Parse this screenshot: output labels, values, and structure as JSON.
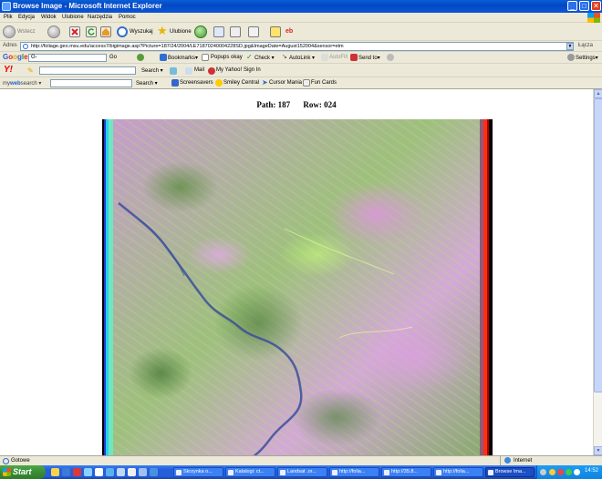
{
  "window": {
    "title": "Browse Image - Microsoft Internet Explorer",
    "min_glyph": "_",
    "max_glyph": "□",
    "close_glyph": "✕"
  },
  "menu": {
    "items": [
      "Plik",
      "Edycja",
      "Widok",
      "Ulubione",
      "Narzędzia",
      "Pomoc"
    ]
  },
  "toolbar": {
    "back_label": "Wstecz",
    "search_label": "Wyszukaj",
    "favorites_label": "Ulubione"
  },
  "address": {
    "label": "Adres",
    "url": "http://foliage.geo.msu.edu/access7/bigimage.asp?Picture=187/24/2004/LE71870240004228SD.jpg&ImageDate=August152004&sensor=etm",
    "go_label": "Łącza"
  },
  "google": {
    "logo": "Google",
    "input_value": "G-",
    "go_label": "Go",
    "bookmarks_label": "Bookmarks▾",
    "popups_label": "Popups okay",
    "check_label": "Check ▾",
    "autolink_label": "AutoLink ▾",
    "autofill_label": "AutoFill",
    "sendto_label": "Send to▾",
    "settings_label": "Settings▾"
  },
  "yahoo": {
    "logo": "Y!",
    "search_label": "Search ▾",
    "mail_label": "Mail",
    "myyahoo_label": "My Yahoo!",
    "signin_label": "Sign In"
  },
  "mws": {
    "logo_prefix": "my",
    "logo_mid": "web",
    "logo_suffix": "search ▾",
    "search_label": "Search ▾",
    "screensavers_label": "Screensavers",
    "smiley_label": "Smiley Central",
    "cursor_label": "Cursor Mania",
    "funcards_label": "Fun Cards"
  },
  "page": {
    "path_label": "Path: 187",
    "row_label": "Row: 024"
  },
  "status": {
    "text": "Gotowe",
    "zone": "Internet"
  },
  "taskbar": {
    "start_label": "Start",
    "buttons": [
      "Skrzynka o...",
      "Katalogi: ct...",
      "Landsat .or...",
      "http://folia...",
      "http://35.8...",
      "http://folia...",
      "Browse Ima..."
    ],
    "clock": "14:52"
  }
}
